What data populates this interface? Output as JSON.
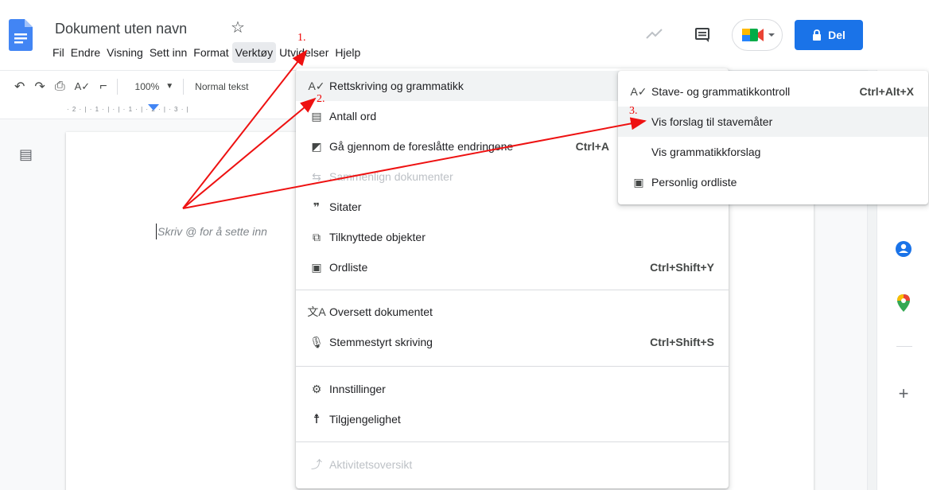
{
  "document": {
    "title": "Dokument uten navn",
    "placeholder": "Skriv @ for å sette inn"
  },
  "menubar": {
    "items": [
      "Fil",
      "Endre",
      "Visning",
      "Sett inn",
      "Format",
      "Verktøy",
      "Utvidelser",
      "Hjelp"
    ],
    "active": "Verktøy"
  },
  "header": {
    "share_label": "Del"
  },
  "toolbar": {
    "zoom": "100%",
    "style": "Normal tekst",
    "ruler_marks": "· 2 · | · 1 · | · | · 1 · | · 2 · | · 3 · |"
  },
  "tools_menu": {
    "items": [
      {
        "label": "Rettskriving og grammatikk",
        "icon": "spellcheck-icon",
        "shortcut": "",
        "highlighted": true,
        "disabled": false
      },
      {
        "label": "Antall ord",
        "icon": "word-count-icon",
        "shortcut": "",
        "highlighted": false,
        "disabled": false
      },
      {
        "label": "Gå gjennom de foreslåtte endringene",
        "icon": "review-edits-icon",
        "shortcut": "Ctrl+A",
        "highlighted": false,
        "disabled": false
      },
      {
        "label": "Sammenlign dokumenter",
        "icon": "compare-icon",
        "shortcut": "",
        "highlighted": false,
        "disabled": true
      },
      {
        "label": "Sitater",
        "icon": "quote-icon",
        "shortcut": "",
        "highlighted": false,
        "disabled": false
      },
      {
        "label": "Tilknyttede objekter",
        "icon": "linked-objects-icon",
        "shortcut": "",
        "highlighted": false,
        "disabled": false
      },
      {
        "label": "Ordliste",
        "icon": "dictionary-icon",
        "shortcut": "Ctrl+Shift+Y",
        "highlighted": false,
        "disabled": false
      },
      {
        "label": "Oversett dokumentet",
        "icon": "translate-icon",
        "shortcut": "",
        "highlighted": false,
        "disabled": false
      },
      {
        "label": "Stemmestyrt skriving",
        "icon": "mic-icon",
        "shortcut": "Ctrl+Shift+S",
        "highlighted": false,
        "disabled": false
      },
      {
        "label": "Innstillinger",
        "icon": "preferences-icon",
        "shortcut": "",
        "highlighted": false,
        "disabled": false
      },
      {
        "label": "Tilgjengelighet",
        "icon": "accessibility-icon",
        "shortcut": "",
        "highlighted": false,
        "disabled": false
      },
      {
        "label": "Aktivitetsoversikt",
        "icon": "activity-icon",
        "shortcut": "",
        "highlighted": false,
        "disabled": true
      }
    ]
  },
  "spelling_submenu": {
    "items": [
      {
        "label": "Stave- og grammatikkontroll",
        "icon": "spellcheck-icon",
        "shortcut": "Ctrl+Alt+X",
        "highlighted": false
      },
      {
        "label": "Vis forslag til stavemåter",
        "icon": "",
        "shortcut": "",
        "highlighted": true
      },
      {
        "label": "Vis grammatikkforslag",
        "icon": "",
        "shortcut": "",
        "highlighted": false
      },
      {
        "label": "Personlig ordliste",
        "icon": "dictionary-icon",
        "shortcut": "",
        "highlighted": false
      }
    ]
  },
  "annotations": {
    "step1": "1.",
    "step2": "2.",
    "step3": "3."
  },
  "colors": {
    "accent": "#1a73e8",
    "annotation": "#ee1111"
  }
}
